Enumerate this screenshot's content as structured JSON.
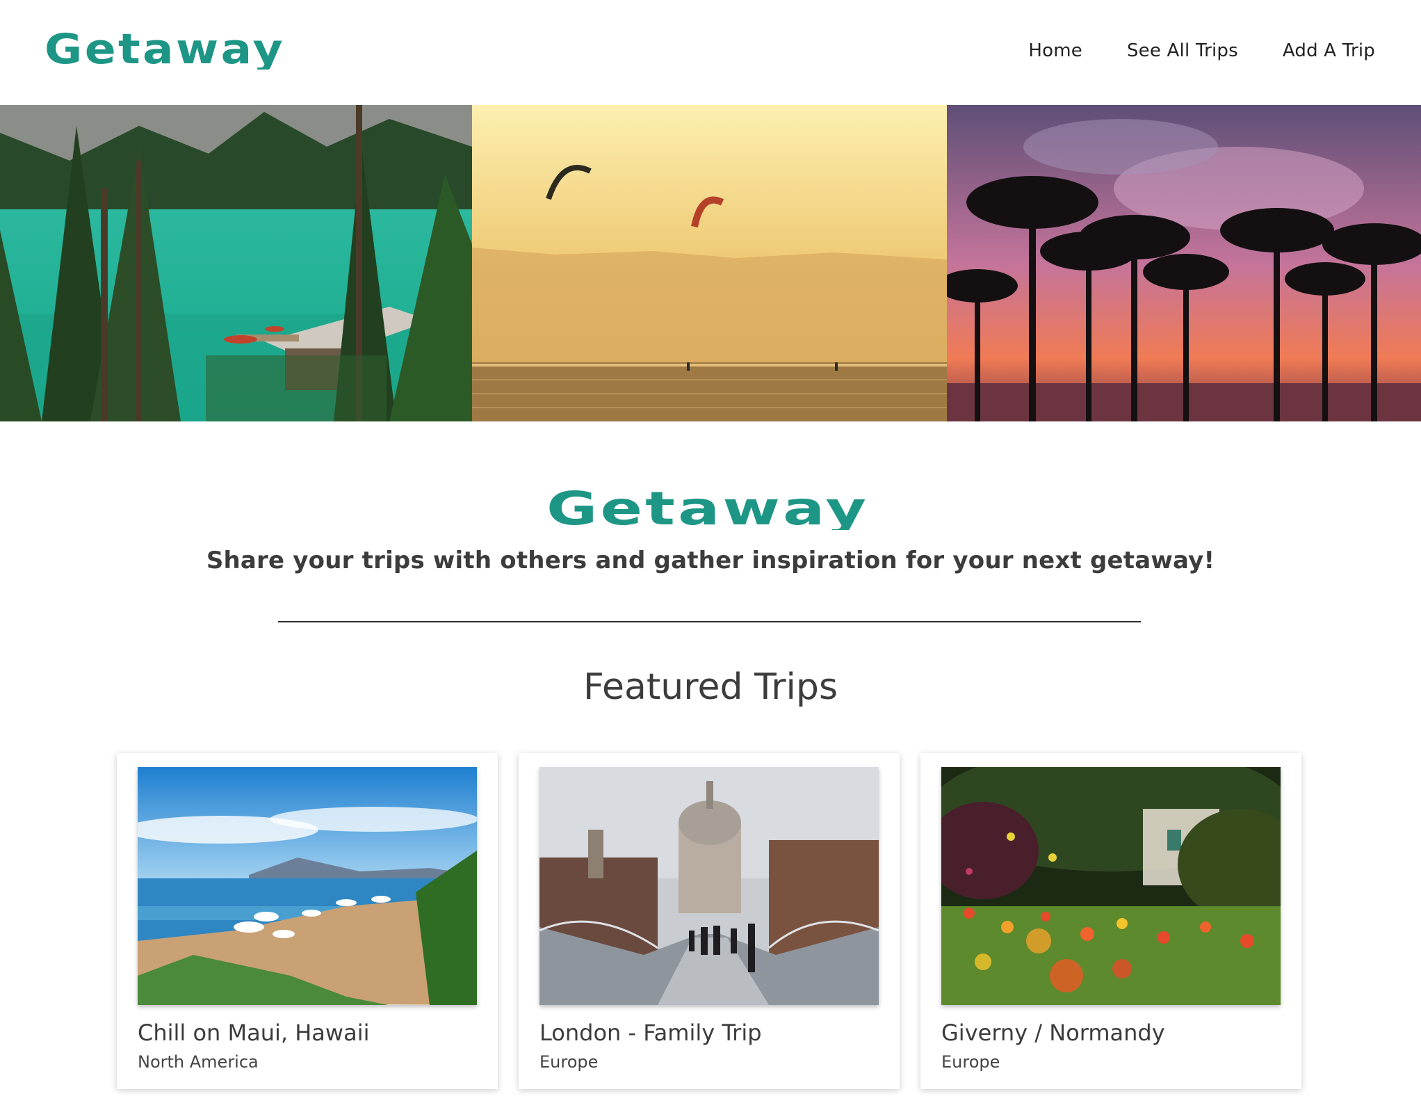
{
  "brand": {
    "logo_text": "Getaway",
    "accent_color": "#1e9686"
  },
  "nav": {
    "links": [
      {
        "label": "Home"
      },
      {
        "label": "See All Trips"
      },
      {
        "label": "Add A Trip"
      }
    ]
  },
  "hero": {
    "images": [
      {
        "icon": "lake-forest-photo"
      },
      {
        "icon": "kitesurf-sunset-photo"
      },
      {
        "icon": "palm-tree-sunset-photo"
      }
    ]
  },
  "intro": {
    "logo_text": "Getaway",
    "tagline": "Share your trips with others and gather inspiration for your next getaway!"
  },
  "featured": {
    "title": "Featured Trips",
    "cards": [
      {
        "title": "Chill on Maui, Hawaii",
        "region": "North America",
        "icon": "beach-photo"
      },
      {
        "title": "London - Family Trip",
        "region": "Europe",
        "icon": "london-bridge-photo"
      },
      {
        "title": "Giverny / Normandy",
        "region": "Europe",
        "icon": "garden-flowers-photo"
      }
    ]
  }
}
